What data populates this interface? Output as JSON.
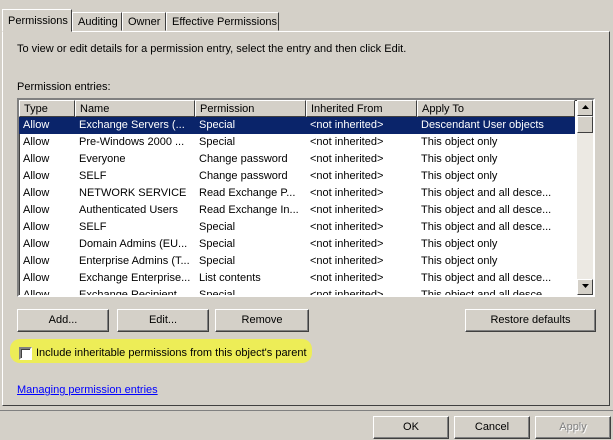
{
  "tabs": [
    "Permissions",
    "Auditing",
    "Owner",
    "Effective Permissions"
  ],
  "instructions": "To view or edit details for a permission entry, select the entry and then click Edit.",
  "entries_label": "Permission entries:",
  "columns": [
    "Type",
    "Name",
    "Permission",
    "Inherited From",
    "Apply To"
  ],
  "rows": [
    [
      "Allow",
      "Exchange Servers (...",
      "Special",
      "<not inherited>",
      "Descendant User objects"
    ],
    [
      "Allow",
      "Pre-Windows 2000 ...",
      "Special",
      "<not inherited>",
      "This object only"
    ],
    [
      "Allow",
      "Everyone",
      "Change password",
      "<not inherited>",
      "This object only"
    ],
    [
      "Allow",
      "SELF",
      "Change password",
      "<not inherited>",
      "This object only"
    ],
    [
      "Allow",
      "NETWORK SERVICE",
      "Read Exchange P...",
      "<not inherited>",
      "This object and all desce..."
    ],
    [
      "Allow",
      "Authenticated Users",
      "Read Exchange In...",
      "<not inherited>",
      "This object and all desce..."
    ],
    [
      "Allow",
      "SELF",
      "Special",
      "<not inherited>",
      "This object and all desce..."
    ],
    [
      "Allow",
      "Domain Admins (EU...",
      "Special",
      "<not inherited>",
      "This object only"
    ],
    [
      "Allow",
      "Enterprise Admins (T...",
      "Special",
      "<not inherited>",
      "This object only"
    ],
    [
      "Allow",
      "Exchange Enterprise...",
      "List contents",
      "<not inherited>",
      "This object and all desce..."
    ],
    [
      "Allow",
      "Exchange Recipient ...",
      "Special",
      "<not inherited>",
      "This object and all desce..."
    ]
  ],
  "selected_row": 0,
  "buttons": {
    "add": "Add...",
    "edit": "Edit...",
    "remove": "Remove",
    "restore": "Restore defaults"
  },
  "inherit_checkbox": {
    "label": "Include inheritable permissions from this object's parent",
    "checked": false
  },
  "link": "Managing permission entries",
  "dialog": {
    "ok": "OK",
    "cancel": "Cancel",
    "apply": "Apply"
  },
  "colors": {
    "selection": "#0a246a",
    "highlight": "#f0f04a",
    "face": "#d4d0c8"
  }
}
